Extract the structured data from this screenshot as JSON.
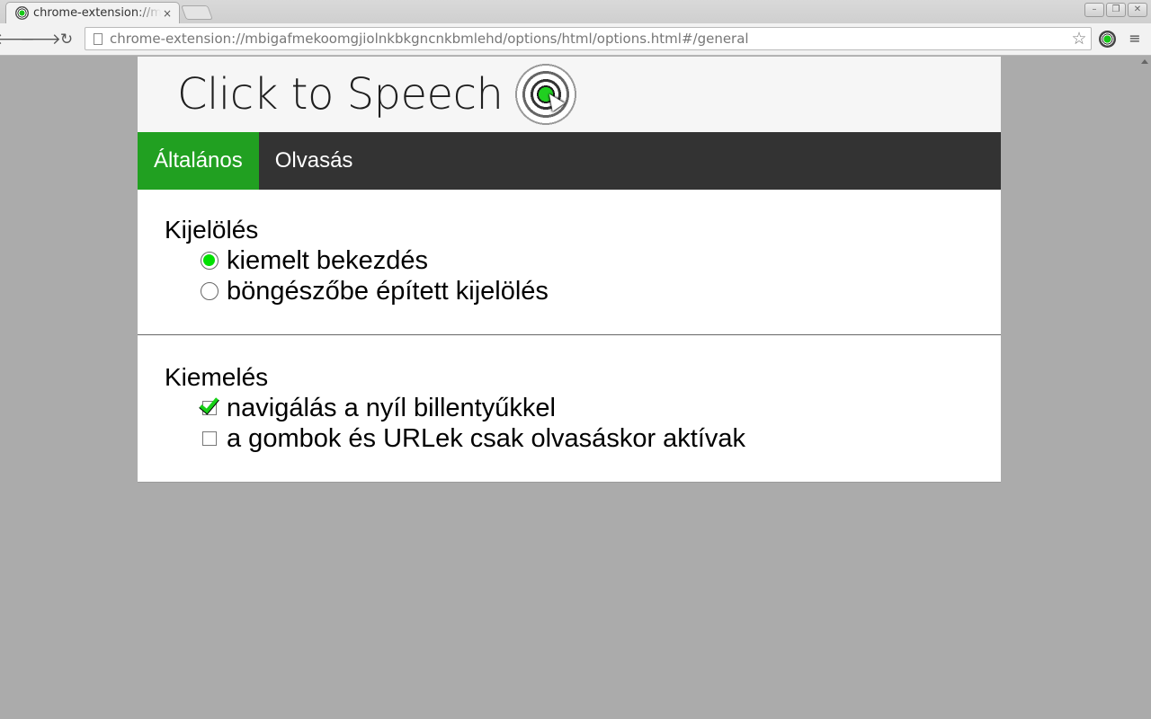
{
  "browser": {
    "tab_title": "chrome-extension://mbigafmekoomgjiolnkbkgncnkbmlehd/options/html/options.html#/general",
    "tab_close": "×",
    "url": "chrome-extension://mbigafmekoomgjiolnkbkgncnkbmlehd/options/html/options.html#/general",
    "back": "🡐",
    "forward": "🡒",
    "reload": "↻",
    "star": "☆",
    "menu": "≡",
    "window_minimize": "–",
    "window_maximize": "❐",
    "window_close": "✕"
  },
  "header": {
    "title": "Click to Speech"
  },
  "nav": {
    "tabs": [
      {
        "label": "Általános",
        "active": true
      },
      {
        "label": "Olvasás",
        "active": false
      }
    ]
  },
  "sections": [
    {
      "title": "Kijelölés",
      "type": "radio",
      "options": [
        {
          "label": "kiemelt bekezdés",
          "checked": true
        },
        {
          "label": "böngészőbe épített kijelölés",
          "checked": false
        }
      ]
    },
    {
      "title": "Kiemelés",
      "type": "checkbox",
      "options": [
        {
          "label": "navigálás a nyíl billentyűkkel",
          "checked": true
        },
        {
          "label": "a gombok és URLek csak olvasáskor aktívak",
          "checked": false
        }
      ]
    }
  ],
  "colors": {
    "accent": "#21a021",
    "navbar": "#333333",
    "check": "#00e000",
    "page_background": "#ababab"
  }
}
